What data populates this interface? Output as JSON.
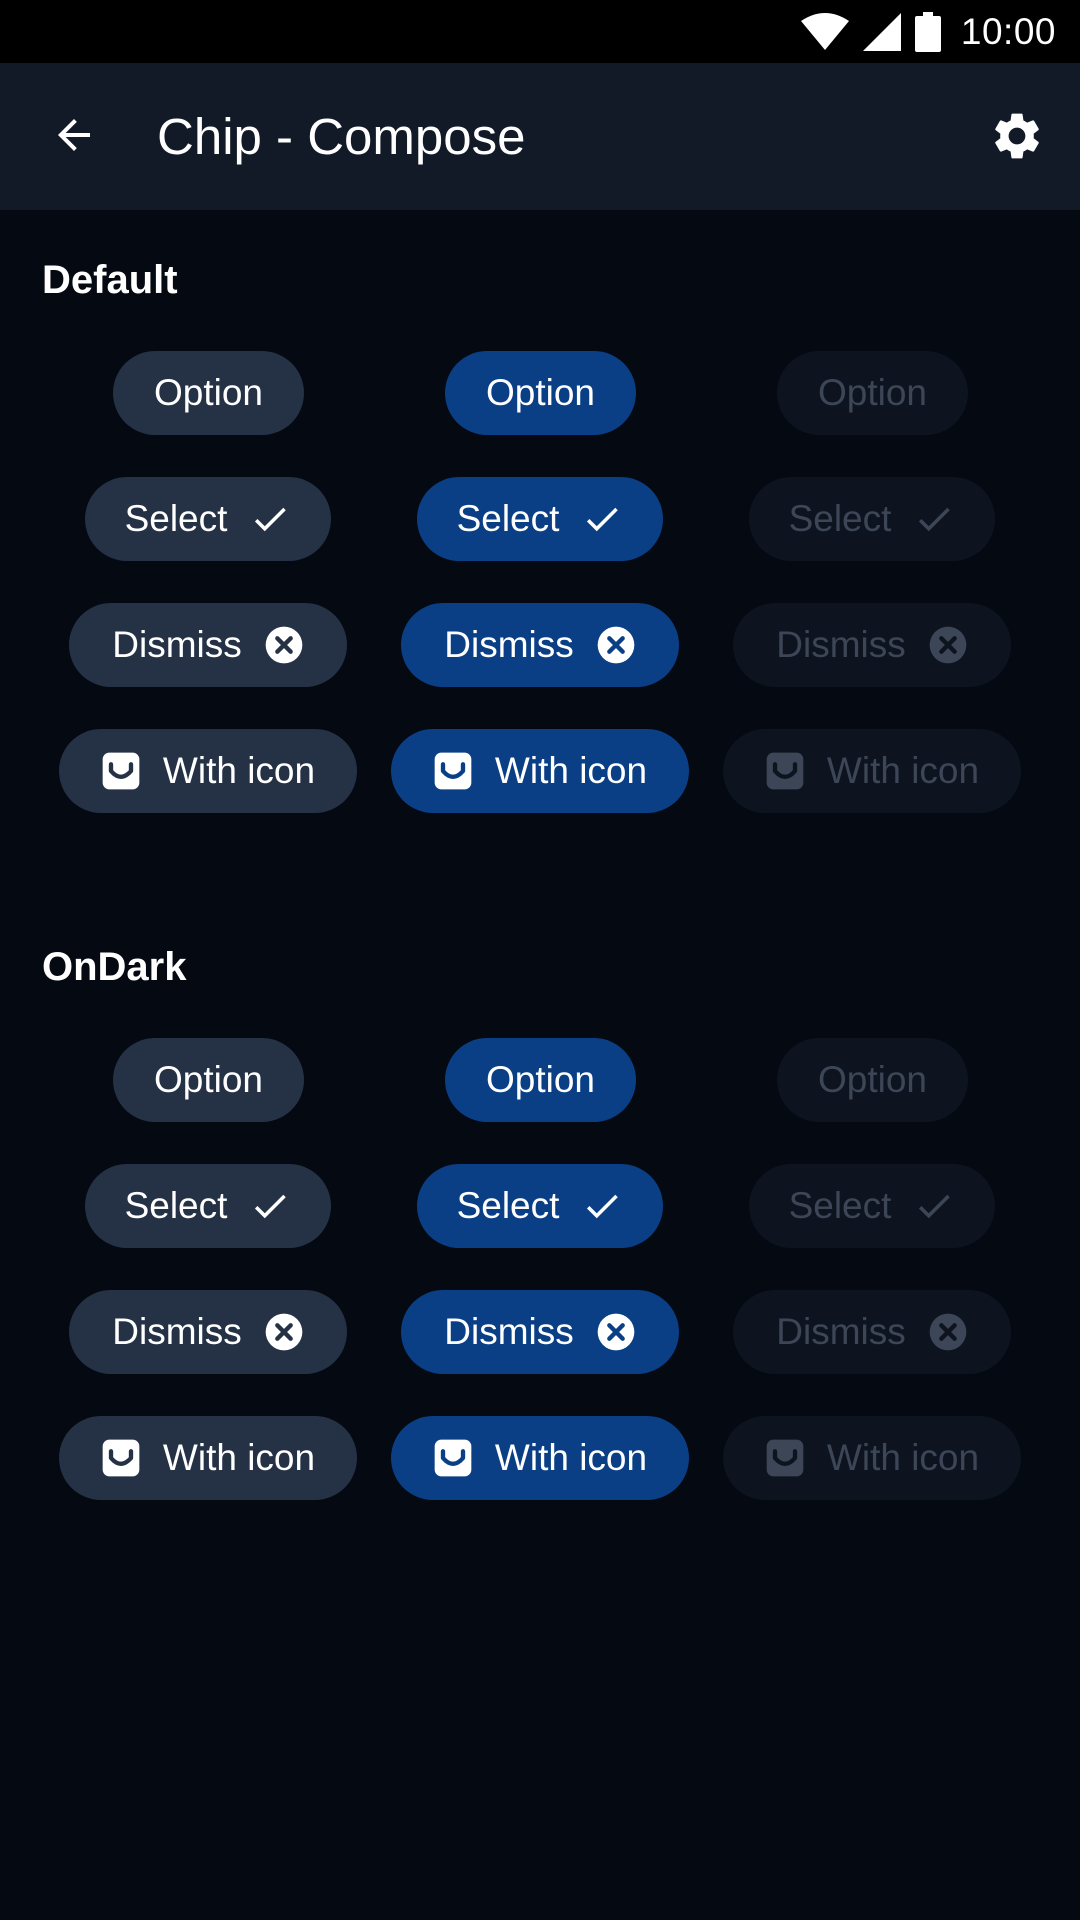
{
  "status_bar": {
    "time": "10:00",
    "icons": [
      "wifi-icon",
      "signal-icon",
      "battery-icon"
    ]
  },
  "app_bar": {
    "title": "Chip - Compose",
    "back_icon": "arrow-back-icon",
    "settings_icon": "gear-icon"
  },
  "sections": [
    {
      "title": "Default",
      "rows": [
        {
          "label": "Option",
          "icon": "none"
        },
        {
          "label": "Select",
          "icon": "check-icon"
        },
        {
          "label": "Dismiss",
          "icon": "close-circle-icon"
        },
        {
          "label": "With icon",
          "icon": "inbox-icon"
        }
      ]
    },
    {
      "title": "OnDark",
      "rows": [
        {
          "label": "Option",
          "icon": "none"
        },
        {
          "label": "Select",
          "icon": "check-icon"
        },
        {
          "label": "Dismiss",
          "icon": "close-circle-icon"
        },
        {
          "label": "With icon",
          "icon": "inbox-icon"
        }
      ]
    }
  ],
  "chip_states": [
    "default",
    "selected",
    "disabled"
  ],
  "colors": {
    "background": "#040912",
    "app_bar": "#121a28",
    "chip_default": "#253246",
    "chip_selected": "#0a3f86",
    "chip_disabled": "#0d141f",
    "text_disabled": "#3c4656"
  }
}
